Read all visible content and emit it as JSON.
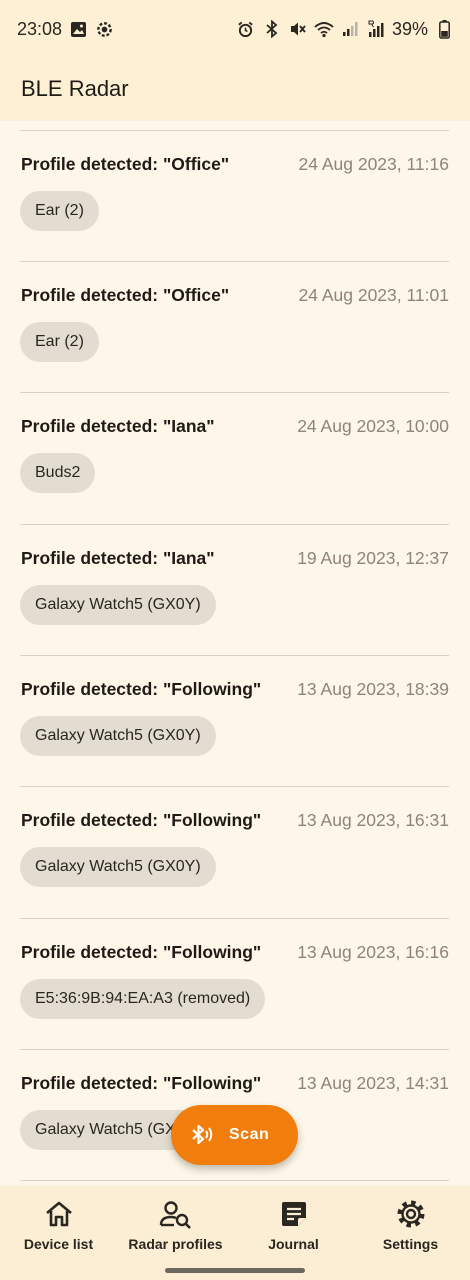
{
  "status_bar": {
    "time": "23:08",
    "battery": "39%",
    "icons_left": [
      "image-icon",
      "settings-sync-icon"
    ],
    "icons_right": [
      "alarm-icon",
      "bluetooth-icon",
      "mute-icon",
      "wifi-icon",
      "signal-icon",
      "signal-roaming-icon",
      "battery-icon"
    ]
  },
  "app_bar": {
    "title": "BLE Radar"
  },
  "journal": [
    {
      "title": "Profile detected: \"Office\"",
      "date": "24 Aug 2023, 11:16",
      "device": "Ear (2)"
    },
    {
      "title": "Profile detected: \"Office\"",
      "date": "24 Aug 2023, 11:01",
      "device": "Ear (2)"
    },
    {
      "title": "Profile detected: \"Iana\"",
      "date": "24 Aug 2023, 10:00",
      "device": "Buds2"
    },
    {
      "title": "Profile detected: \"Iana\"",
      "date": "19 Aug 2023, 12:37",
      "device": "Galaxy Watch5 (GX0Y)"
    },
    {
      "title": "Profile detected: \"Following\"",
      "date": "13 Aug 2023, 18:39",
      "device": "Galaxy Watch5 (GX0Y)"
    },
    {
      "title": "Profile detected: \"Following\"",
      "date": "13 Aug 2023, 16:31",
      "device": "Galaxy Watch5 (GX0Y)"
    },
    {
      "title": "Profile detected: \"Following\"",
      "date": "13 Aug 2023, 16:16",
      "device": "E5:36:9B:94:EA:A3 (removed)"
    },
    {
      "title": "Profile detected: \"Following\"",
      "date": "13 Aug 2023, 14:31",
      "device": "Galaxy Watch5 (GX0Y)"
    }
  ],
  "fab": {
    "label": "Scan",
    "icon": "bluetooth-searching-icon",
    "color": "#f07d0c"
  },
  "bottom_nav": [
    {
      "label": "Device list",
      "icon": "home-icon"
    },
    {
      "label": "Radar profiles",
      "icon": "person-search-icon"
    },
    {
      "label": "Journal",
      "icon": "notes-icon"
    },
    {
      "label": "Settings",
      "icon": "gear-icon"
    }
  ],
  "colors": {
    "background": "#fdf6e9",
    "app_bar": "#fdf0d5",
    "accent": "#f07d0c",
    "chip": "#e3ddd1"
  }
}
